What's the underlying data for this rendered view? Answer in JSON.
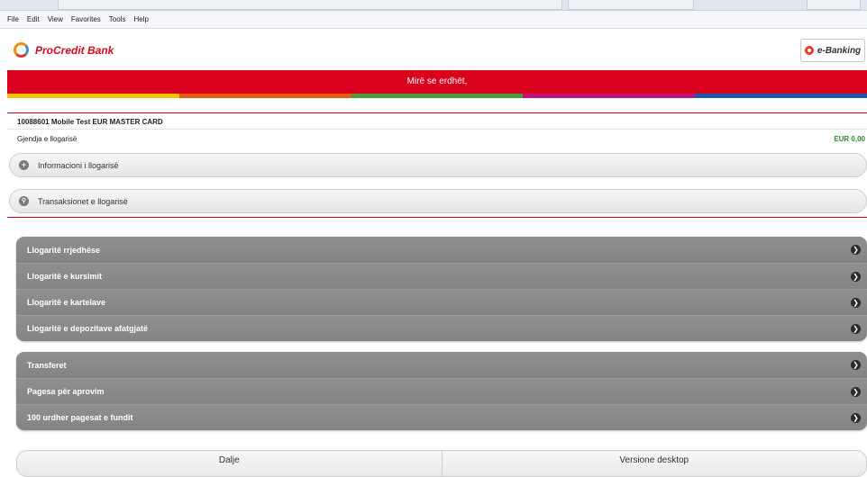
{
  "browser": {
    "menu": [
      "File",
      "Edit",
      "View",
      "Favorites",
      "Tools",
      "Help"
    ]
  },
  "header": {
    "brand": "ProCredit Bank",
    "ebanking_label": "e-Banking"
  },
  "welcome_text": "Mirë se erdhët,",
  "stripe_colors": [
    "#f5c400",
    "#e35d10",
    "#4d9a3b",
    "#c2157c",
    "#1d5aa6"
  ],
  "account": {
    "title": "10088601 Mobile Test EUR MASTER CARD",
    "balance_label": "Gjendja e llogarisë",
    "balance_value": "EUR 0,00",
    "sections": [
      {
        "label": "Informacioni i llogarisë",
        "icon": "plus-icon"
      },
      {
        "label": "Transaksionet e llogarisë",
        "icon": "search-icon"
      }
    ]
  },
  "menu_groups": [
    {
      "items": [
        "Llogaritë rrjedhëse",
        "Llogaritë e kursimit",
        "Llogaritë e kartelave",
        "Llogaritë e depozitave afatgjatë"
      ]
    },
    {
      "items": [
        "Transferet",
        "Pagesa për aprovim",
        "100 urdher pagesat e fundit"
      ]
    }
  ],
  "footer": {
    "logout": "Dalje",
    "desktop": "Versione desktop"
  },
  "colors": {
    "brand_red": "#d9001b",
    "balance_green": "#2f8a2f",
    "menu_gray": "#8a8a8a"
  }
}
